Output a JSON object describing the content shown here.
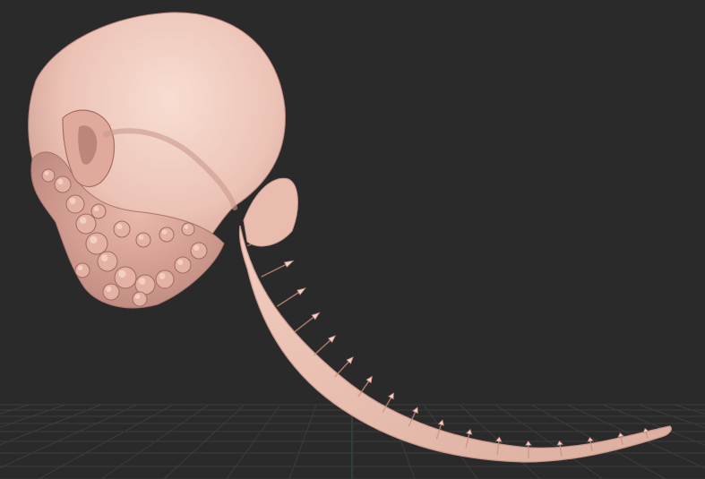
{
  "viewport": {
    "background_color": "#2b2a2a",
    "grid_color": "#3c3c3c",
    "grid_axis_color": "#2f5a35"
  },
  "model": {
    "subject": "sculpted-skull-with-segmented-tail",
    "material_color": "#ecc3b6",
    "shadow_color": "#c48f84",
    "highlight_color": "#f8ddd2",
    "spike_count": 18
  }
}
